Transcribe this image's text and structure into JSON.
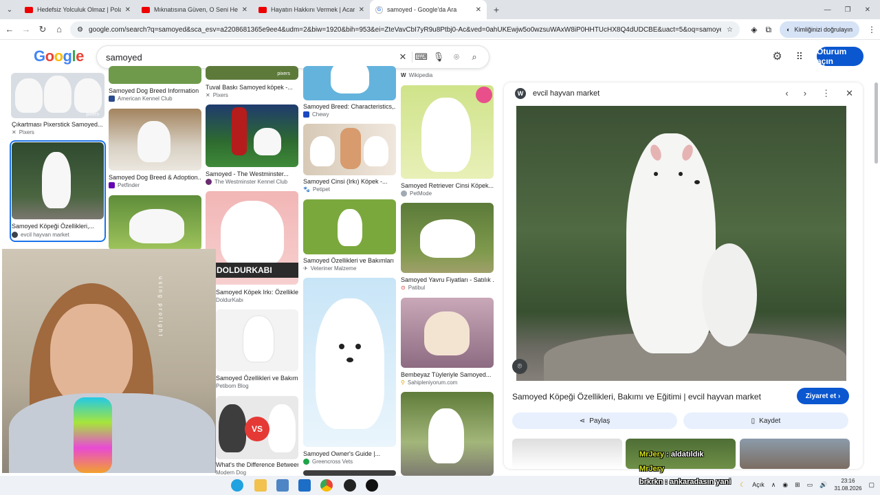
{
  "browser": {
    "tabs": [
      {
        "title": "Hedefsiz Yolculuk Olmaz | Polat",
        "icon": "youtube-icon"
      },
      {
        "title": "Mıknatısına Güven, O Seni Hedef",
        "icon": "youtube-icon"
      },
      {
        "title": "Hayatın Hakkını Vermek | Acar",
        "icon": "youtube-icon"
      },
      {
        "title": "samoyed - Google'da Ara",
        "icon": "google-icon",
        "active": true
      }
    ],
    "url": "google.com/search?q=samoyed&sca_esv=a2208681365e9ee4&udm=2&biw=1920&bih=953&ei=ZteVavCbI7yR9u8Ptbj0-Ac&ved=0ahUKEwjw5o0wzsuWAxW8iP0HHTUcHX8Q4dUDCBE&uact=5&oq=samoyed&gs_lp=Eg...",
    "verify_label": "Kimliğinizi doğrulayın"
  },
  "google": {
    "logo": [
      "G",
      "o",
      "o",
      "g",
      "l",
      "e"
    ],
    "query": "samoyed",
    "signin_label": "Oturum açın"
  },
  "results": {
    "col1": [
      {
        "caption": "Çıkartması Pixerstick Samoyed...",
        "source": "Pixers",
        "watermark": "pixers"
      },
      {
        "caption": "Samoyed Köpeği Özellikleri,...",
        "source": "evcil hayvan market"
      }
    ],
    "col2": [
      {
        "caption": "Samoyed Dog Breed Information",
        "source": "American Kennel Club"
      },
      {
        "caption": "Samoyed Dog Breed & Adoption...",
        "source": "Petfinder"
      }
    ],
    "col3": [
      {
        "caption": "Tuval Baskı Samoyed köpek -...",
        "source": "Pixers",
        "watermark": "pixers"
      },
      {
        "caption": "Samoyed - The Westminster...",
        "source": "The Westminster Kennel Club"
      },
      {
        "caption": "Samoyed Köpek Irkı: Özellikleri,...",
        "source": "DoldurKabı",
        "watermark": "DOLDURKABI"
      },
      {
        "caption": "Samoyed Özellikleri ve Bakımı »...",
        "source": "Petibom Blog"
      },
      {
        "caption": "What's the Difference Between...",
        "source": "Modern Dog",
        "badge": "VS"
      }
    ],
    "col4": [
      {
        "caption": "Samoyed Breed: Characteristics,...",
        "source": "Chewy"
      },
      {
        "caption": "Samoyed Cinsi (Irkı) Köpek -...",
        "source": "Petipet"
      },
      {
        "caption": "Samoyed Özellikleri ve Bakımları",
        "source": "Veteriner Malzeme"
      },
      {
        "caption": "Samoyed Owner's Guide |...",
        "source": "Greencross Vets"
      }
    ],
    "col5": [
      {
        "source": "Wikipedia"
      },
      {
        "caption": "Samoyed Retriever Cinsi Köpek...",
        "source": "PetMode"
      },
      {
        "caption": "Samoyed Yavru Fiyatları - Satılık ...",
        "source": "Patibul"
      },
      {
        "caption": "Bembeyaz Tüyleriyle Samoyed...",
        "source": "Sahipleniyorum.com"
      }
    ]
  },
  "panel": {
    "site": "evcil hayvan market",
    "title": "Samoyed Köpeği Özellikleri, Bakımı ve Eğitimi | evcil hayvan market",
    "visit_label": "Ziyaret et",
    "share_label": "Paylaş",
    "save_label": "Kaydet"
  },
  "overlay": {
    "chat": [
      {
        "user": "MrJery",
        "msg": "aldatıldık"
      },
      {
        "user": "MrJery",
        "msg": ""
      },
      {
        "user": "brkrkn",
        "msg": "ankaradasın yani"
      }
    ],
    "webcam_text": "using  prolight"
  },
  "taskbar": {
    "weather": "Açık",
    "time": "23:16",
    "date": "31.08.2026"
  }
}
